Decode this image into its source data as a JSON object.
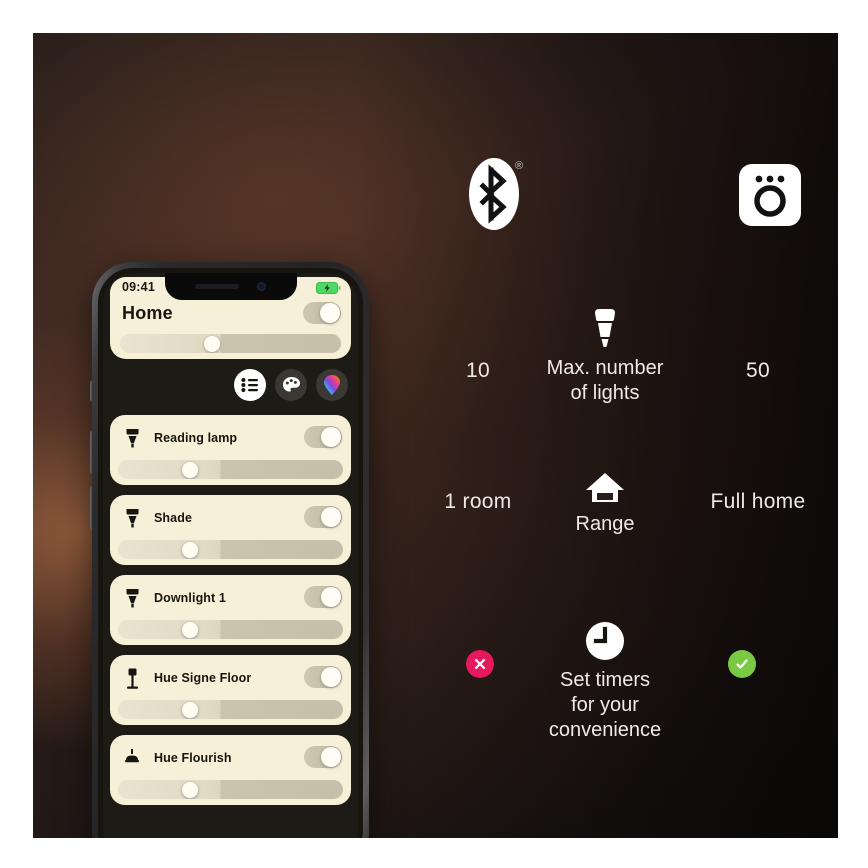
{
  "comparison": {
    "rows": [
      {
        "id": "max-lights",
        "left": "10",
        "caption_line1": "Max. number",
        "caption_line2": "of lights",
        "right": "50",
        "icon": "bulb-icon"
      },
      {
        "id": "range",
        "left": "1 room",
        "caption_line1": "Range",
        "caption_line2": "",
        "right": "Full home",
        "icon": "house-icon"
      },
      {
        "id": "timers",
        "left": "",
        "caption_line1": "Set timers",
        "caption_line2": "for your",
        "caption_line3": "convenience",
        "right": "",
        "icon": "clock-icon",
        "left_badge": "cross-badge",
        "right_badge": "check-badge"
      }
    ]
  },
  "top_icons": {
    "bluetooth": "bluetooth-icon",
    "bluetooth_registered": "®",
    "bridge": "hue-bridge-icon"
  },
  "phone": {
    "status_bar": {
      "time": "09:41",
      "location_icon": "location-arrow-icon",
      "battery_icon": "battery-charging-icon"
    },
    "header": {
      "title": "Home",
      "toggle": "on",
      "brightness_percent": 42
    },
    "segmented": [
      {
        "id": "list",
        "icon": "list-icon",
        "active": true
      },
      {
        "id": "scenes",
        "icon": "palette-icon",
        "active": false
      },
      {
        "id": "color",
        "icon": "color-drop-icon",
        "active": false
      }
    ],
    "lights": [
      {
        "name": "Reading lamp",
        "icon": "bulb-spot-icon",
        "toggle": "on",
        "brightness_percent": 32
      },
      {
        "name": "Shade",
        "icon": "bulb-spot-icon",
        "toggle": "on",
        "brightness_percent": 32
      },
      {
        "name": "Downlight 1",
        "icon": "bulb-spot-icon",
        "toggle": "on",
        "brightness_percent": 32
      },
      {
        "name": "Hue Signe Floor",
        "icon": "floor-lamp-icon",
        "toggle": "on",
        "brightness_percent": 32
      },
      {
        "name": "Hue Flourish",
        "icon": "ceiling-lamp-icon",
        "toggle": "on",
        "brightness_percent": 32
      }
    ]
  },
  "colors": {
    "card": "#f7f0d8",
    "text_dark": "#17150f",
    "text_light": "#efe9e5",
    "cross_badge": "#e6195f",
    "check_badge": "#7ac943",
    "battery_green": "#4cd964"
  }
}
